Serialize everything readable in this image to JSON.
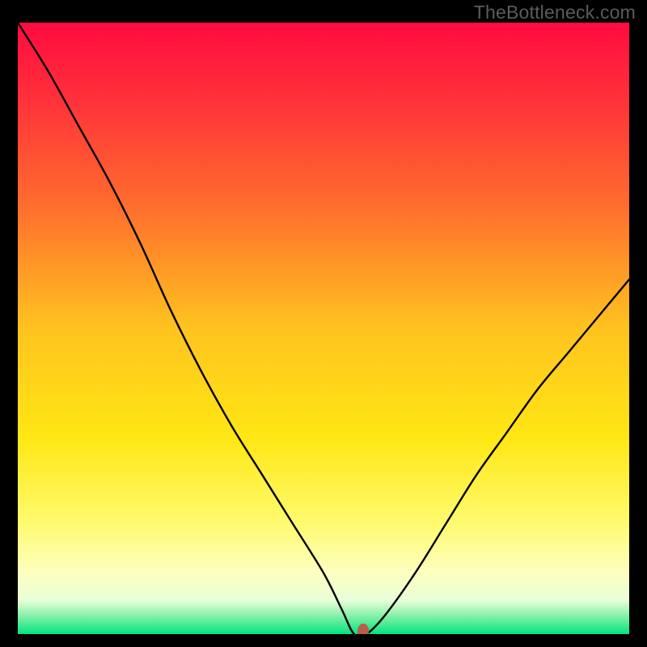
{
  "watermark": "TheBottleneck.com",
  "chart_data": {
    "type": "line",
    "title": "",
    "xlabel": "",
    "ylabel": "",
    "xlim": [
      0,
      100
    ],
    "ylim": [
      0,
      100
    ],
    "x": [
      0,
      5,
      10,
      15,
      20,
      25,
      30,
      35,
      40,
      45,
      50,
      53,
      55,
      57,
      60,
      65,
      70,
      75,
      80,
      85,
      90,
      95,
      100
    ],
    "values": [
      100,
      92,
      83,
      74,
      64,
      53,
      43,
      34,
      26,
      18,
      10,
      4,
      0,
      0,
      3,
      10,
      18,
      26,
      33,
      40,
      46,
      52,
      58
    ],
    "marker": {
      "x": 56.5,
      "y": 0
    },
    "gradient_stops": [
      {
        "offset": 0.0,
        "color": "#ff0b40"
      },
      {
        "offset": 0.12,
        "color": "#ff2f3a"
      },
      {
        "offset": 0.3,
        "color": "#ff6d2e"
      },
      {
        "offset": 0.5,
        "color": "#ffc31f"
      },
      {
        "offset": 0.68,
        "color": "#ffe714"
      },
      {
        "offset": 0.82,
        "color": "#fffb70"
      },
      {
        "offset": 0.9,
        "color": "#fdffc0"
      },
      {
        "offset": 0.945,
        "color": "#e8ffd8"
      },
      {
        "offset": 0.97,
        "color": "#87f0a8"
      },
      {
        "offset": 1.0,
        "color": "#00e57e"
      }
    ]
  }
}
